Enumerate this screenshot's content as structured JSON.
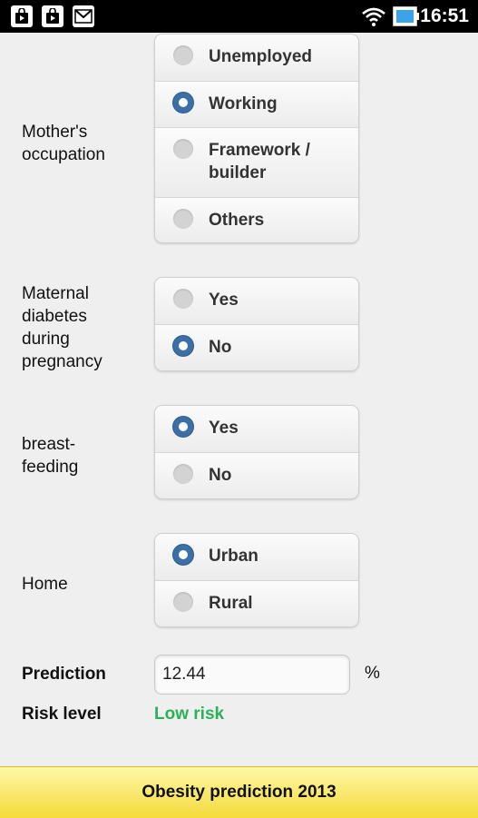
{
  "status_bar": {
    "time": "16:51",
    "left_icons": [
      "play-store-notification-icon",
      "play-store-notification-icon",
      "gmail-icon"
    ],
    "right_icons": [
      "wifi-icon",
      "battery-icon"
    ]
  },
  "form": {
    "occupation": {
      "label": "Mother's\noccupation",
      "options": [
        {
          "label": "Unemployed",
          "selected": false
        },
        {
          "label": "Working",
          "selected": true
        },
        {
          "label": "Framework /\nbuilder",
          "selected": false
        },
        {
          "label": "Others",
          "selected": false
        }
      ]
    },
    "diabetes": {
      "label": "Maternal\ndiabetes\nduring\npregnancy",
      "options": [
        {
          "label": "Yes",
          "selected": false
        },
        {
          "label": "No",
          "selected": true
        }
      ]
    },
    "breastfeeding": {
      "label": "breast-\nfeeding",
      "options": [
        {
          "label": "Yes",
          "selected": true
        },
        {
          "label": "No",
          "selected": false
        }
      ]
    },
    "home": {
      "label": "Home",
      "options": [
        {
          "label": "Urban",
          "selected": true
        },
        {
          "label": "Rural",
          "selected": false
        }
      ]
    }
  },
  "result": {
    "prediction_label": "Prediction",
    "prediction_value": "12.44",
    "prediction_unit": "%",
    "risk_label": "Risk level",
    "risk_value": "Low risk",
    "risk_color": "#2db05a"
  },
  "footer": {
    "title": "Obesity prediction 2013",
    "background": "#f4da3a"
  }
}
